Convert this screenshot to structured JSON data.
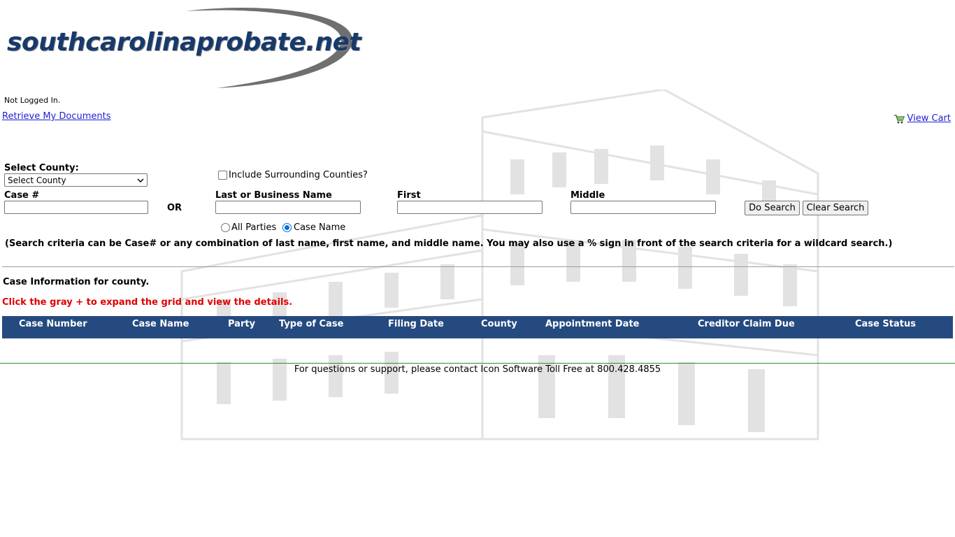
{
  "logo": {
    "text": "southcarolinaprobate.net"
  },
  "status": {
    "login": "Not Logged In."
  },
  "links": {
    "retrieve_docs": "Retrieve My Documents",
    "view_cart": "View Cart"
  },
  "search": {
    "county_label": "Select County:",
    "county_value": "Select County",
    "surrounding_label": "Include Surrounding Counties?",
    "case_label": "Case #",
    "or_label": "OR",
    "last_label": "Last or Business Name",
    "first_label": "First",
    "middle_label": "Middle",
    "case_value": "",
    "last_value": "",
    "first_value": "",
    "middle_value": "",
    "do_search": "Do Search",
    "clear_search": "Clear Search",
    "radio_all_parties": "All Parties",
    "radio_case_name": "Case Name",
    "selected_radio": "Case Name",
    "hint": "(Search criteria can be Case# or any combination of last name, first name, and middle name. You may also use a % sign in front of the search criteria for a wildcard search.)"
  },
  "results": {
    "info": "Case Information for county.",
    "expand_hint": "Click the gray + to expand the grid and view the details.",
    "columns": [
      "Case Number",
      "Case Name",
      "Party",
      "Type of Case",
      "Filing Date",
      "County",
      "Appointment Date",
      "Creditor Claim Due",
      "Case Status"
    ],
    "rows": []
  },
  "footer": {
    "text": "For questions or support, please contact Icon Software Toll Free at 800.428.4855"
  },
  "colors": {
    "header_bg": "#254a80",
    "alert_red": "#e00000",
    "link_blue": "#1f1fd4",
    "logo_navy": "#173a6b"
  }
}
